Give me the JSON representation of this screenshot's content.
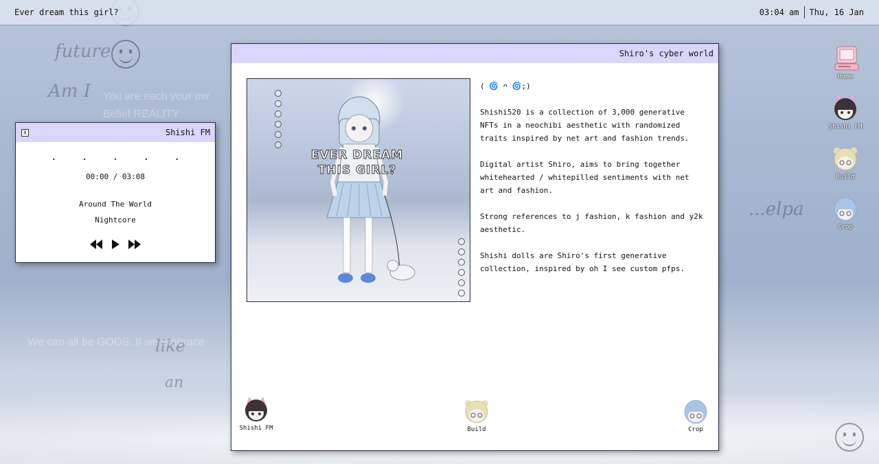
{
  "topbar": {
    "title": "Ever dream this girl?",
    "time": "03:04 am",
    "date": "Thu, 16 Jan"
  },
  "background": {
    "scribbles": [
      "future",
      "Am I",
      "like",
      "an",
      "...elpa"
    ],
    "texts": [
      "You are each your ow",
      "Belief REALITY",
      "We can all be GODS. If we embrace"
    ]
  },
  "player": {
    "title": "Shishi FM",
    "close_label": "X",
    "dots": ". . . . .",
    "time": "00:00 / 03:08",
    "song": "Around The World",
    "artist": "Nightcore"
  },
  "main": {
    "title": "Shiro's cyber world",
    "artwork": {
      "title_line1": "EVER DREAM",
      "title_line2": "THIS GIRL?"
    },
    "emote": "( 🌀 ᴖ 🌀;)",
    "paragraphs": [
      "Shishi520 is a collection of 3,000 generative NFTs in a neochibi aesthetic with randomized traits inspired by net art and fashion trends.",
      "Digital artist Shiro, aims to bring together whitehearted / whitepilled sentiments with net art and fashion.",
      "Strong references to j fashion, k fashion and y2k aesthetic.",
      "Shishi dolls are Shiro's first generative collection, inspired by oh I see custom pfps."
    ],
    "bottom_icons": [
      {
        "label": "Shishi FM",
        "hair": "#3a3236",
        "ears": "#f4a7c4"
      },
      {
        "label": "Build",
        "hair": "#e9dfb6",
        "ears": "#e9dfb6"
      },
      {
        "label": "Crop",
        "hair": "#a9c4e6",
        "ears": "#a9c4e6"
      }
    ]
  },
  "desktop_icons": [
    {
      "label": "Home",
      "icon": "computer-icon"
    },
    {
      "label": "Shishi FM",
      "icon": "shishi-fm-avatar-icon"
    },
    {
      "label": "Build",
      "icon": "build-avatar-icon"
    },
    {
      "label": "Crop",
      "icon": "crop-avatar-icon"
    }
  ],
  "colors": {
    "titlebar": "#d9d6fb",
    "window_border": "#2b2b3a"
  }
}
